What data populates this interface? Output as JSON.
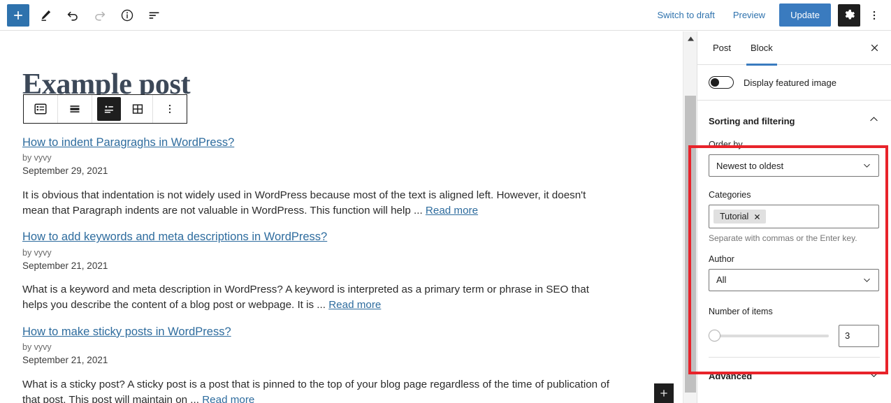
{
  "toolbar": {
    "add_block_label": "+",
    "tools_icon": "pencil-icon",
    "undo_icon": "undo-icon",
    "redo_icon": "redo-icon",
    "info_icon": "info-icon",
    "list_view_icon": "list-view-icon",
    "switch_to_draft": "Switch to draft",
    "preview": "Preview",
    "update": "Update",
    "settings_icon": "gear-icon",
    "options_icon": "kebab-menu-icon"
  },
  "block_toolbar": {
    "items": [
      {
        "name": "query-loop-block-icon",
        "title": "Query Loop"
      },
      {
        "name": "align-icon",
        "title": "Change alignment"
      },
      {
        "name": "list-view-layout-icon",
        "title": "List view",
        "active": true
      },
      {
        "name": "grid-view-layout-icon",
        "title": "Grid view",
        "active": false
      },
      {
        "name": "more-options-icon",
        "title": "Options"
      }
    ]
  },
  "editor": {
    "post_title": "Example post",
    "posts": [
      {
        "title": "How to indent Paragraghs in WordPress?",
        "byline": "by vyvy",
        "date": "September 29, 2021",
        "excerpt": "It is obvious that indentation is not widely used in WordPress because most of the text is aligned left. However, it doesn't mean that Paragraph indents are not valuable in WordPress. This function will help ...",
        "read_more": "Read more"
      },
      {
        "title": "How to add keywords and meta descriptions in WordPress?",
        "byline": "by vyvy",
        "date": "September 21, 2021",
        "excerpt": "What is a keyword and meta description in WordPress? A keyword is interpreted as a primary term or phrase in SEO that helps you describe the content of a blog post or webpage. It is ...",
        "read_more": "Read more"
      },
      {
        "title": "How to make sticky posts in WordPress?",
        "byline": "by vyvy",
        "date": "September 21, 2021",
        "excerpt": "What is a sticky post? A sticky post is a post that is pinned to the top of your blog page regardless of the time of publication of that post. This post will maintain on ...",
        "read_more": "Read more"
      }
    ],
    "appender_label": "+"
  },
  "sidebar": {
    "tabs": [
      {
        "label": "Post",
        "active": false
      },
      {
        "label": "Block",
        "active": true
      }
    ],
    "close_icon": "close-icon",
    "featured_image": {
      "toggle_label": "Display featured image",
      "enabled": false
    },
    "sorting_and_filtering": {
      "title": "Sorting and filtering",
      "collapse_icon": "chevron-up-icon",
      "order_by": {
        "label": "Order by",
        "value": "Newest to oldest"
      },
      "categories": {
        "label": "Categories",
        "tokens": [
          "Tutorial"
        ],
        "token_remove_icon": "close-icon",
        "help": "Separate with commas or the Enter key."
      },
      "author": {
        "label": "Author",
        "value": "All"
      },
      "number_of_items": {
        "label": "Number of items",
        "value": "3",
        "slider_percent": 0
      }
    },
    "advanced": {
      "title": "Advanced",
      "expand_icon": "chevron-down-icon"
    }
  },
  "annotation": {
    "highlight_color": "#e8232a"
  },
  "colors": {
    "accent_blue": "#3a7bbf",
    "link_blue": "#2e6c9e",
    "dark": "#1e1e1e",
    "title": "#3c4858"
  }
}
